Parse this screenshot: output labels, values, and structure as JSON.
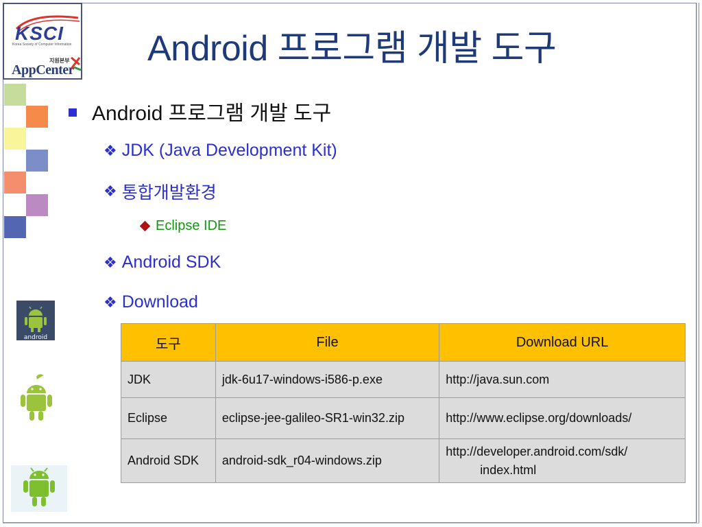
{
  "logo": {
    "ksci": "KSCI",
    "ksci_subtitle": "Korea Society of Computer Information",
    "appcenter_top": "지원본부",
    "appcenter": "AppCenter"
  },
  "slide": {
    "title": "Android 프로그램 개발 도구",
    "bullet_main": "Android 프로그램 개발 도구",
    "sub_bullets": {
      "jdk": "JDK (Java Development Kit)",
      "ide_env": "통합개발환경",
      "eclipse": "Eclipse IDE",
      "sdk": "Android SDK",
      "download": "Download"
    },
    "android_logo_text": "android"
  },
  "table": {
    "headers": [
      "도구",
      "File",
      "Download URL"
    ],
    "rows": [
      {
        "tool": "JDK",
        "file": "jdk-6u17-windows-i586-p.exe",
        "url": "http://java.sun.com",
        "url2": ""
      },
      {
        "tool": "Eclipse",
        "file": "eclipse-jee-galileo-SR1-win32.zip",
        "url": "http://www.eclipse.org/downloads/",
        "url2": ""
      },
      {
        "tool": "Android SDK",
        "file": "android-sdk_r04-windows.zip",
        "url": "http://developer.android.com/sdk/",
        "url2": "index.html"
      }
    ]
  },
  "colors": {
    "title": "#1f3a78",
    "bullet_blue": "#2b2fcf",
    "bullet_green": "#0d9a0d",
    "header_yellow": "#ffc000",
    "cell_gray": "#dcdcdc"
  }
}
